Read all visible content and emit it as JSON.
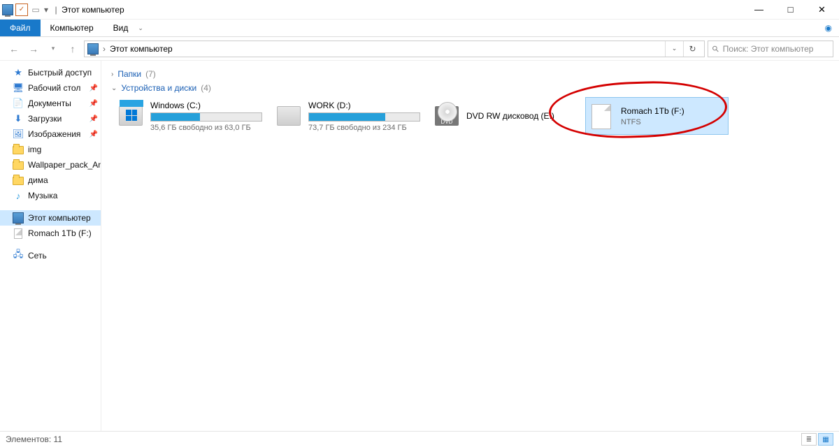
{
  "title": "Этот компьютер",
  "menu": {
    "file": "Файл",
    "computer": "Компьютер",
    "view": "Вид"
  },
  "path": {
    "location": "Этот компьютер"
  },
  "search_placeholder": "Поиск: Этот компьютер",
  "tree": {
    "quick": "Быстрый доступ",
    "desktop": "Рабочий стол",
    "documents": "Документы",
    "downloads": "Загрузки",
    "pictures": "Изображения",
    "img": "img",
    "wallpaper": "Wallpaper_pack_An",
    "dima": "дима",
    "music": "Музыка",
    "this_pc": "Этот компьютер",
    "romach": "Romach 1Tb (F:)",
    "network": "Сеть"
  },
  "sections": {
    "folders": "Папки",
    "folders_count": "(7)",
    "drives": "Устройства и диски",
    "drives_count": "(4)"
  },
  "drives": {
    "c": {
      "name": "Windows (C:)",
      "free": "35,6 ГБ свободно из 63,0 ГБ",
      "used_pct": 44
    },
    "d": {
      "name": "WORK (D:)",
      "free": "73,7 ГБ свободно из 234 ГБ",
      "used_pct": 69
    },
    "e": {
      "name": "DVD RW дисковод (E:)"
    },
    "f": {
      "name": "Romach 1Tb (F:)",
      "fs": "NTFS"
    }
  },
  "status": {
    "items": "Элементов:",
    "count": "11"
  }
}
